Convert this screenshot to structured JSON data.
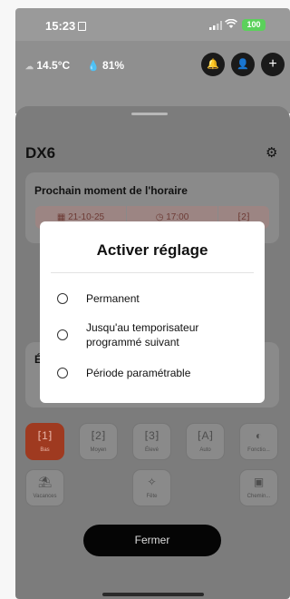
{
  "status_bar": {
    "time": "15:23",
    "battery": "100"
  },
  "weather": {
    "temperature": "14.5°C",
    "humidity": "81%"
  },
  "sheet": {
    "title": "DX6",
    "schedule_card": {
      "title": "Prochain moment de l'horaire",
      "date": "21-10-25",
      "time": "17:00"
    },
    "card2_label": "É",
    "modes": [
      "Bas",
      "Moyen",
      "Élevé",
      "Auto",
      "Fonctio..."
    ],
    "modes2": [
      "Vacances",
      "Fête",
      "Chemin..."
    ],
    "close_label": "Fermer"
  },
  "modal": {
    "title": "Activer réglage",
    "options": [
      "Permanent",
      "Jusqu'au temporisateur programmé suivant",
      "Période paramétrable"
    ]
  },
  "colors": {
    "accent": "#c84b2a",
    "battery": "#34c759",
    "close_button": "#000000"
  }
}
